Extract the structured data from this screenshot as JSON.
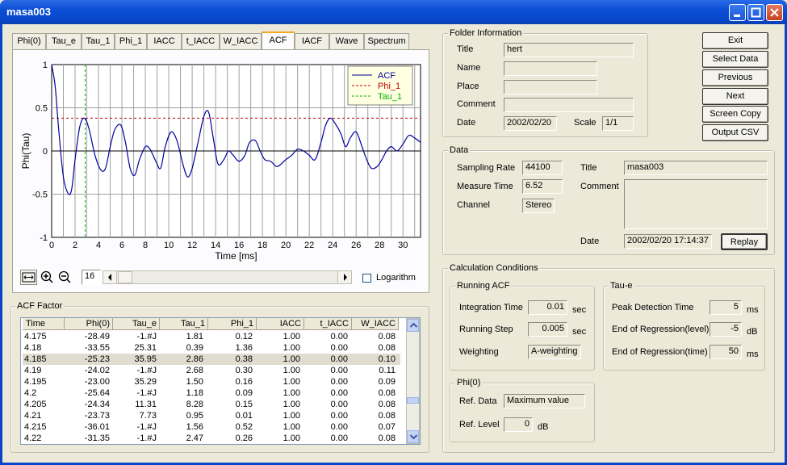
{
  "window": {
    "title": "masa003"
  },
  "tabs": [
    "Phi(0)",
    "Tau_e",
    "Tau_1",
    "Phi_1",
    "IACC",
    "t_IACC",
    "W_IACC",
    "ACF",
    "IACF",
    "Wave",
    "Spectrum"
  ],
  "active_tab": "ACF",
  "chart_data": {
    "type": "line",
    "xlabel": "Time [ms]",
    "ylabel": "Phi(Tau)",
    "xlim": [
      0,
      31.5
    ],
    "ylim": [
      -1,
      1
    ],
    "x_ticks": [
      0,
      2,
      4,
      6,
      8,
      10,
      12,
      14,
      16,
      18,
      20,
      22,
      24,
      26,
      28,
      30
    ],
    "y_ticks": [
      1,
      0.5,
      0,
      -0.5,
      -1
    ],
    "y_tick_labels": [
      "1",
      "0.5",
      "0",
      "-0.5",
      "-1"
    ],
    "grid": true,
    "legend_position": "top-right",
    "series": [
      {
        "name": "ACF",
        "color": "#0000a0",
        "x": [
          0,
          0.3,
          0.6,
          1.0,
          1.4,
          1.7,
          2.0,
          2.4,
          2.8,
          3.2,
          3.7,
          4.2,
          4.6,
          5.0,
          5.4,
          5.9,
          6.3,
          6.7,
          7.1,
          7.5,
          8.0,
          8.4,
          8.9,
          9.3,
          9.7,
          10.2,
          10.7,
          11.2,
          11.6,
          12.0,
          12.5,
          13.0,
          13.4,
          13.8,
          14.2,
          14.7,
          15.1,
          15.5,
          16.0,
          16.5,
          16.9,
          17.4,
          17.8,
          18.2,
          18.7,
          19.2,
          19.6,
          20.0,
          20.5,
          21.0,
          21.5,
          22.0,
          22.5,
          23.0,
          23.4,
          23.8,
          24.2,
          24.7,
          25.1,
          25.5,
          26.0,
          26.5,
          26.9,
          27.3,
          27.8,
          28.2,
          28.6,
          29.0,
          29.5,
          30.0,
          30.5,
          31.0,
          31.5
        ],
        "y": [
          1.0,
          0.75,
          0.25,
          -0.3,
          -0.49,
          -0.45,
          -0.1,
          0.28,
          0.38,
          0.25,
          -0.05,
          -0.22,
          -0.2,
          0.05,
          0.25,
          0.3,
          0.1,
          -0.2,
          -0.28,
          -0.1,
          0.05,
          0.02,
          -0.12,
          -0.2,
          0.05,
          0.22,
          0.12,
          -0.15,
          -0.3,
          -0.2,
          0.1,
          0.4,
          0.45,
          0.15,
          -0.15,
          -0.1,
          0.0,
          -0.05,
          -0.12,
          -0.05,
          0.1,
          0.12,
          0.0,
          -0.1,
          -0.12,
          -0.18,
          -0.15,
          -0.1,
          -0.05,
          0.02,
          0.0,
          -0.05,
          -0.1,
          0.1,
          0.3,
          0.38,
          0.32,
          0.2,
          0.05,
          0.15,
          0.22,
          0.05,
          -0.1,
          -0.2,
          -0.18,
          -0.1,
          0.0,
          0.05,
          0.0,
          0.08,
          0.18,
          0.15,
          0.1
        ]
      },
      {
        "name": "Phi_1",
        "color": "#c00000",
        "y_const": 0.38
      },
      {
        "name": "Tau_1",
        "color": "#00b000",
        "x_const": 2.86
      }
    ]
  },
  "toolbar": {
    "page": "16",
    "logarithm_label": "Logarithm"
  },
  "acf_factor": {
    "title": "ACF Factor",
    "columns": [
      "Time",
      "Phi(0)",
      "Tau_e",
      "Tau_1",
      "Phi_1",
      "IACC",
      "t_IACC",
      "W_IACC"
    ],
    "rows": [
      [
        "4.175",
        "-28.49",
        "-1.#J",
        "1.81",
        "0.12",
        "1.00",
        "0.00",
        "0.08"
      ],
      [
        "4.18",
        "-33.55",
        "25.31",
        "0.39",
        "1.36",
        "1.00",
        "0.00",
        "0.08"
      ],
      [
        "4.185",
        "-25.23",
        "35.95",
        "2.86",
        "0.38",
        "1.00",
        "0.00",
        "0.10"
      ],
      [
        "4.19",
        "-24.02",
        "-1.#J",
        "2.68",
        "0.30",
        "1.00",
        "0.00",
        "0.11"
      ],
      [
        "4.195",
        "-23.00",
        "35.29",
        "1.50",
        "0.16",
        "1.00",
        "0.00",
        "0.09"
      ],
      [
        "4.2",
        "-25.64",
        "-1.#J",
        "1.18",
        "0.09",
        "1.00",
        "0.00",
        "0.08"
      ],
      [
        "4.205",
        "-24.34",
        "11.31",
        "8.28",
        "0.15",
        "1.00",
        "0.00",
        "0.08"
      ],
      [
        "4.21",
        "-23.73",
        "7.73",
        "0.95",
        "0.01",
        "1.00",
        "0.00",
        "0.08"
      ],
      [
        "4.215",
        "-36.01",
        "-1.#J",
        "1.56",
        "0.52",
        "1.00",
        "0.00",
        "0.07"
      ],
      [
        "4.22",
        "-31.35",
        "-1.#J",
        "2.47",
        "0.26",
        "1.00",
        "0.00",
        "0.08"
      ]
    ],
    "selected_row": 2
  },
  "folder_info": {
    "title": "Folder Information",
    "title_label": "Title",
    "title_value": "hert",
    "name_label": "Name",
    "name_value": "",
    "place_label": "Place",
    "place_value": "",
    "comment_label": "Comment",
    "comment_value": "",
    "date_label": "Date",
    "date_value": "2002/02/20",
    "scale_label": "Scale",
    "scale_value": "1/1"
  },
  "buttons": {
    "exit": "Exit",
    "select_data": "Select Data",
    "previous": "Previous",
    "next": "Next",
    "screen_copy": "Screen Copy",
    "output_csv": "Output CSV",
    "replay": "Replay"
  },
  "data_group": {
    "title": "Data",
    "sampling_rate_label": "Sampling Rate",
    "sampling_rate": "44100",
    "measure_time_label": "Measure Time",
    "measure_time": "6.52",
    "channel_label": "Channel",
    "channel": "Stereo",
    "title_label": "Title",
    "title_value": "masa003",
    "comment_label": "Comment",
    "comment_value": "",
    "date_label": "Date",
    "date_value": "2002/02/20 17:14:37"
  },
  "calc": {
    "title": "Calculation Conditions",
    "running_acf": {
      "title": "Running ACF",
      "integration_time_label": "Integration Time",
      "integration_time": "0.01",
      "integration_unit": "sec",
      "running_step_label": "Running Step",
      "running_step": "0.005",
      "running_step_unit": "sec",
      "weighting_label": "Weighting",
      "weighting": "A-weighting"
    },
    "tau_e": {
      "title": "Tau-e",
      "peak_label": "Peak Detection Time",
      "peak": "5",
      "peak_unit": "ms",
      "eor_level_label": "End of Regression(level)",
      "eor_level": "-5",
      "eor_level_unit": "dB",
      "eor_time_label": "End of Regression(time)",
      "eor_time": "50",
      "eor_time_unit": "ms"
    },
    "phi0": {
      "title": "Phi(0)",
      "ref_data_label": "Ref. Data",
      "ref_data": "Maximum value",
      "ref_level_label": "Ref. Level",
      "ref_level": "0",
      "ref_level_unit": "dB"
    }
  }
}
